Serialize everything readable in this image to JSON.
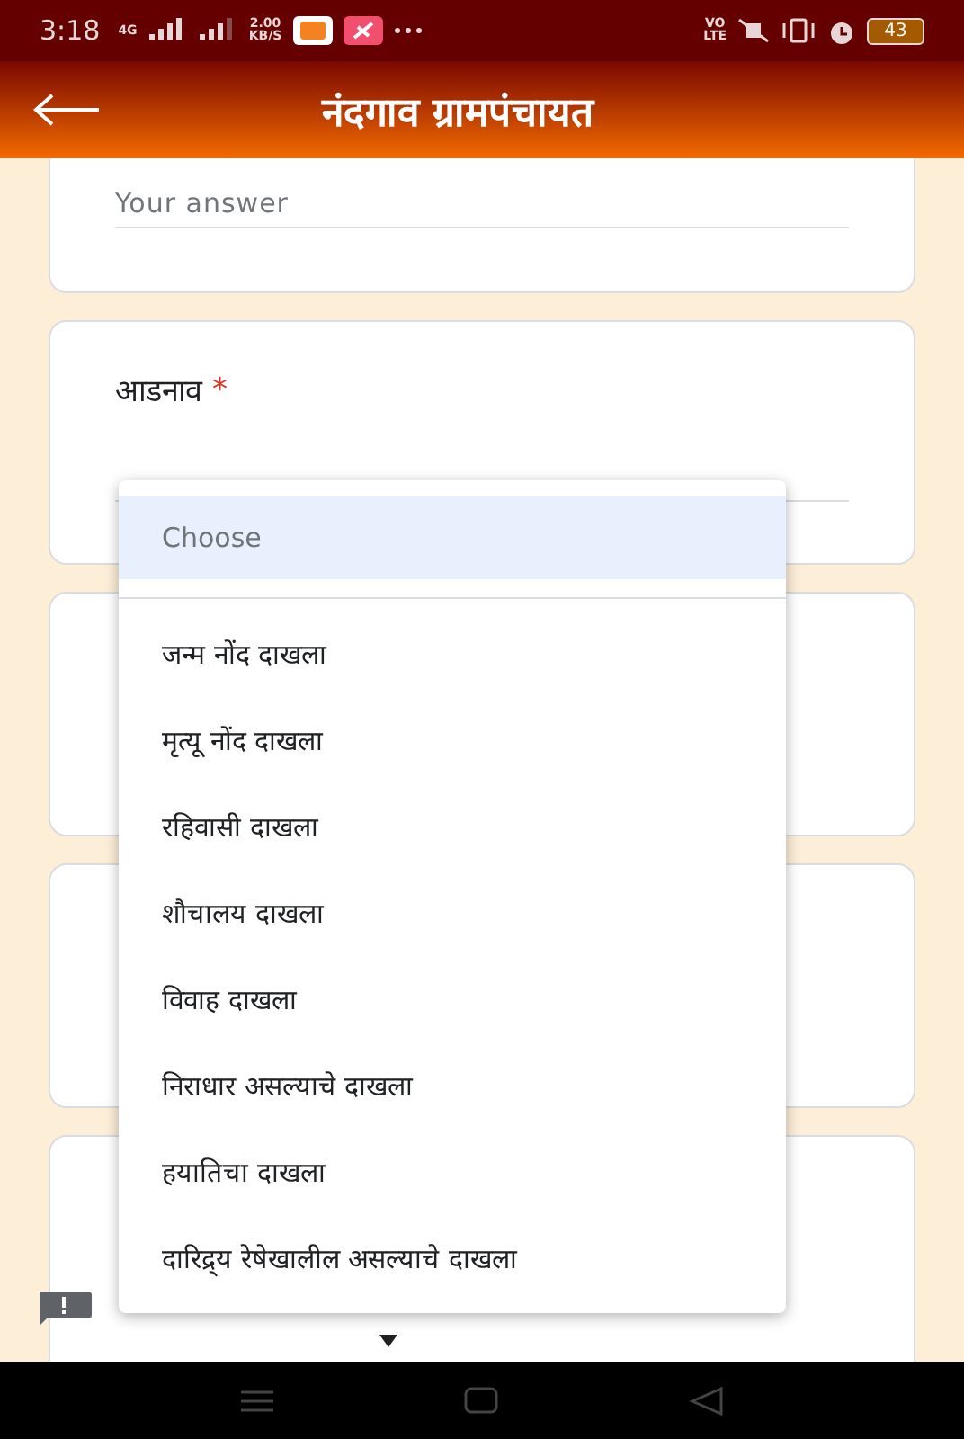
{
  "status_bar": {
    "time": "3:18",
    "network": "4G",
    "speed": "2.00",
    "speed_unit": "KB/S",
    "volte_top": "VO",
    "volte_bottom": "LTE",
    "battery": "43"
  },
  "app_bar": {
    "title": "नंदगाव ग्रामपंचायत"
  },
  "cards": [
    {
      "kind": "answer",
      "placeholder": "Your answer"
    },
    {
      "kind": "question",
      "label": "आडनाव",
      "required_mark": "*"
    },
    {
      "kind": "blank"
    },
    {
      "kind": "blank"
    },
    {
      "kind": "blank"
    }
  ],
  "dropdown": {
    "options": [
      {
        "label": "Choose",
        "selected": true,
        "kind": "placeholder"
      },
      {
        "label": "जन्म नोंद दाखला",
        "selected": false,
        "kind": "option"
      },
      {
        "label": "मृत्यू नोंद दाखला",
        "selected": false,
        "kind": "option"
      },
      {
        "label": "रहिवासी दाखला",
        "selected": false,
        "kind": "option"
      },
      {
        "label": "शौचालय दाखला",
        "selected": false,
        "kind": "option"
      },
      {
        "label": "विवाह दाखला",
        "selected": false,
        "kind": "option"
      },
      {
        "label": "निराधार असल्याचे दाखला",
        "selected": false,
        "kind": "option"
      },
      {
        "label": "हयातिचा दाखला",
        "selected": false,
        "kind": "option"
      },
      {
        "label": "दारिद्र्य रेषेखालील असल्याचे दाखला",
        "selected": false,
        "kind": "option"
      }
    ]
  }
}
